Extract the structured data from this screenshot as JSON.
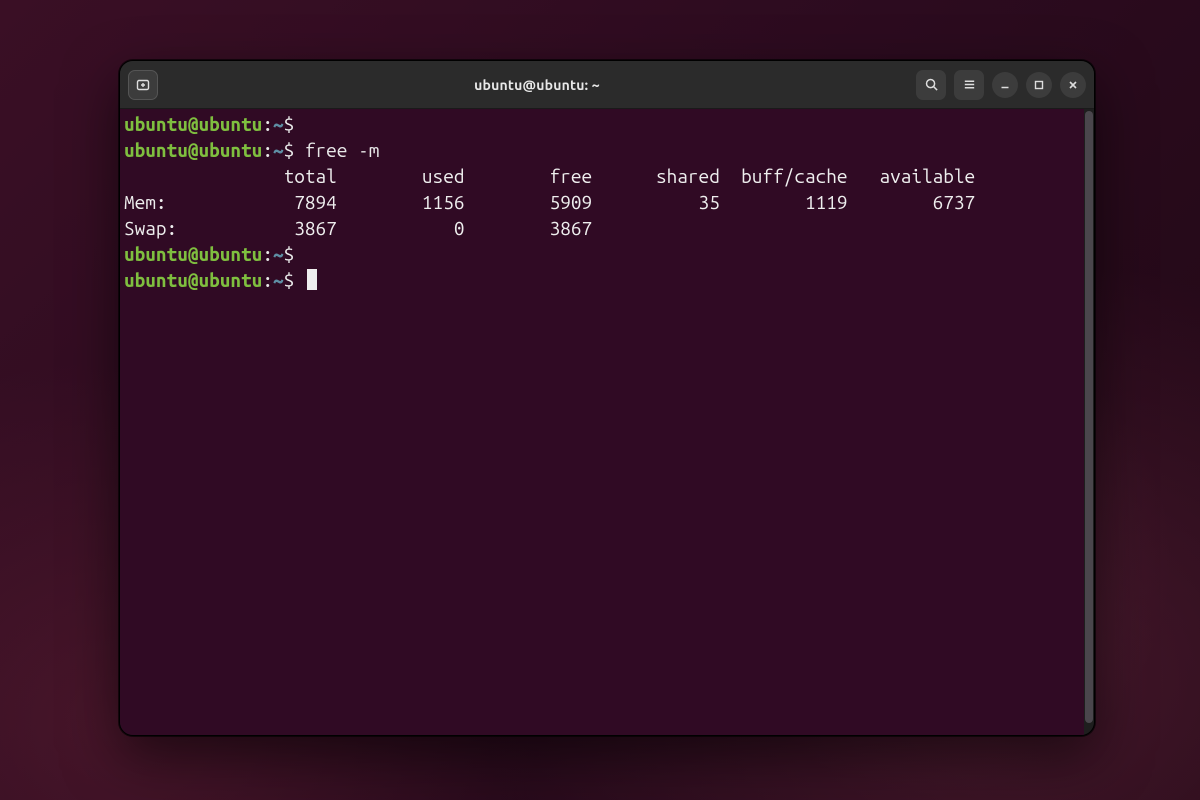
{
  "window": {
    "title": "ubuntu@ubuntu: ~"
  },
  "prompt": {
    "user_host": "ubuntu@ubuntu",
    "separator": ":",
    "path": "~",
    "symbol": "$"
  },
  "session": {
    "lines": [
      {
        "type": "prompt",
        "command": ""
      },
      {
        "type": "prompt",
        "command": "free -m"
      },
      {
        "type": "output",
        "text": "               total        used        free      shared  buff/cache   available"
      },
      {
        "type": "output",
        "text": "Mem:            7894        1156        5909          35        1119        6737"
      },
      {
        "type": "output",
        "text": "Swap:           3867           0        3867"
      },
      {
        "type": "prompt",
        "command": ""
      },
      {
        "type": "prompt",
        "command": "",
        "cursor": true
      }
    ]
  },
  "icons": {
    "new_tab": "new-tab-icon",
    "search": "search-icon",
    "menu": "hamburger-icon",
    "minimize": "minimize-icon",
    "maximize": "maximize-icon",
    "close": "close-icon"
  }
}
